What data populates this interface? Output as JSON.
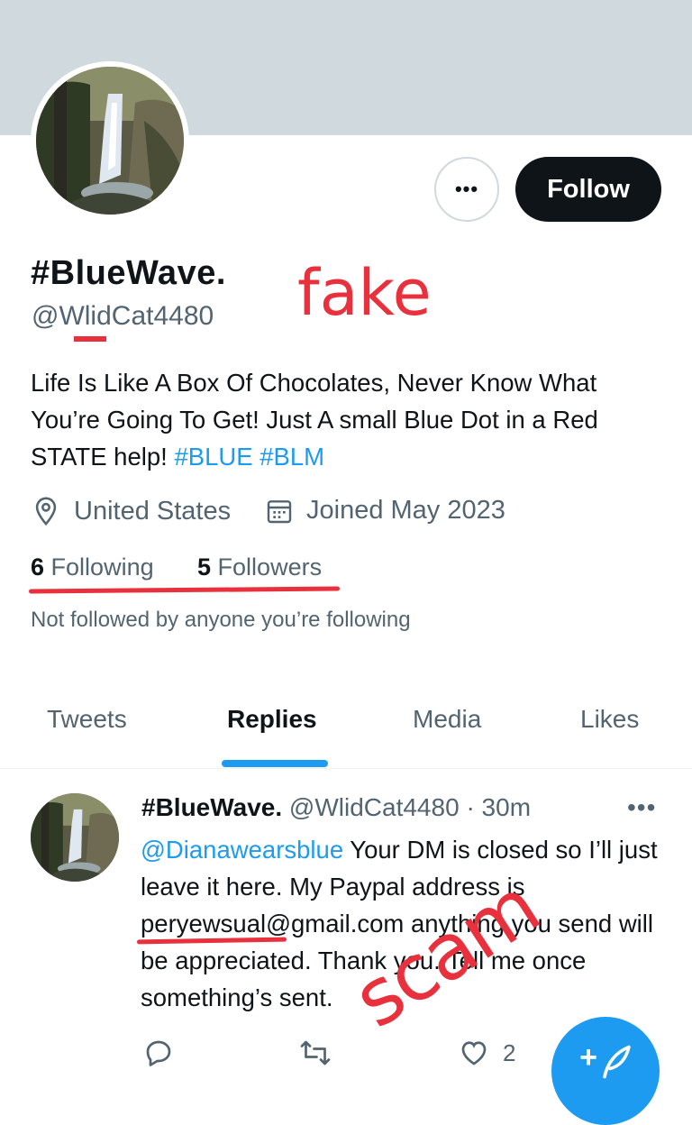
{
  "profile": {
    "display_name": "#BlueWave.",
    "handle": "@WlidCat4480",
    "follow_label": "Follow",
    "more_label": "•••",
    "bio_text": "Life Is Like A Box Of Chocolates, Never Know What You’re Going To Get! Just A small Blue Dot in a Red STATE help! ",
    "bio_hashtags": [
      "#BLUE",
      "#BLM"
    ],
    "location": "United States",
    "joined": "Joined May 2023",
    "following_count": "6",
    "following_label": "Following",
    "followers_count": "5",
    "followers_label": "Followers",
    "not_followed_text": "Not followed by anyone you’re following",
    "icons": {
      "location": "location-pin-icon",
      "calendar": "calendar-icon"
    }
  },
  "annotations": {
    "fake_label": "fake",
    "scam_label": "scam",
    "color": "#e8313c"
  },
  "tabs": [
    {
      "label": "Tweets",
      "active": false
    },
    {
      "label": "Replies",
      "active": true
    },
    {
      "label": "Media",
      "active": false
    },
    {
      "label": "Likes",
      "active": false
    }
  ],
  "tweet": {
    "name": "#BlueWave.",
    "handle": "@WlidCat4480",
    "separator": "·",
    "time": "30m",
    "more_label": "•••",
    "mention": "@Dianawearsblue",
    "text": " Your DM is closed so I’ll just leave it here. My Paypal address is peryewsual@gmail.com anything you send will be appreciated. Thank you. Tell me once something’s sent.",
    "like_count": "2",
    "icons": [
      "reply-icon",
      "retweet-icon",
      "like-icon",
      "share-icon"
    ]
  },
  "fab": {
    "icon": "compose-tweet-icon",
    "plus": "+"
  },
  "colors": {
    "accent": "#1d9bf0",
    "secondary_text": "#536471",
    "banner": "#cfd9de",
    "dark": "#0f1419"
  }
}
